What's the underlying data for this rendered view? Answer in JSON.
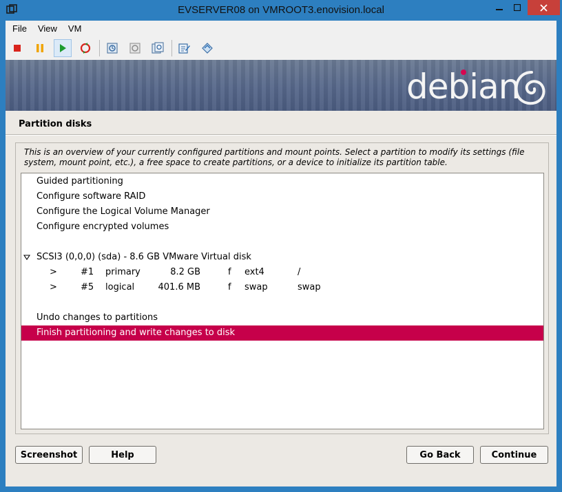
{
  "window": {
    "title": "EVSERVER08 on VMROOT3.enovision.local"
  },
  "menu": {
    "items": [
      "File",
      "View",
      "VM"
    ]
  },
  "toolbar": {
    "buttons": [
      "stop-icon",
      "pause-icon",
      "play-icon",
      "reset-icon",
      "snapshot-icon",
      "revert-snapshot-icon",
      "manage-snapshots-icon",
      "edit-settings-icon",
      "install-tools-icon"
    ],
    "colors": {
      "stop": "#d9241c",
      "pause": "#f0a400",
      "play": "#1d9b2f"
    }
  },
  "banner": {
    "brand": "debian",
    "accent": "#d70751"
  },
  "installer": {
    "title": "Partition disks",
    "help": "This is an overview of your currently configured partitions and mount points. Select a partition to modify its settings (file system, mount point, etc.), a free space to create partitions, or a device to initialize its partition table.",
    "items": {
      "guided": "Guided partitioning",
      "raid": "Configure software RAID",
      "lvm": "Configure the Logical Volume Manager",
      "crypto": "Configure encrypted volumes",
      "disk": "SCSI3 (0,0,0) (sda) - 8.6 GB VMware Virtual disk",
      "undo": "Undo changes to partitions",
      "finish": "Finish partitioning and write changes to disk"
    },
    "partitions": [
      {
        "arrow": ">",
        "num": "#1",
        "type": "primary",
        "size": "8.2 GB",
        "flag": "f",
        "fs": "ext4",
        "mount": "/"
      },
      {
        "arrow": ">",
        "num": "#5",
        "type": "logical",
        "size": "401.6 MB",
        "flag": "f",
        "fs": "swap",
        "mount": "swap"
      }
    ],
    "selection_color": "#c6004a",
    "buttons": {
      "screenshot": "Screenshot",
      "help": "Help",
      "back": "Go Back",
      "continue": "Continue"
    }
  }
}
